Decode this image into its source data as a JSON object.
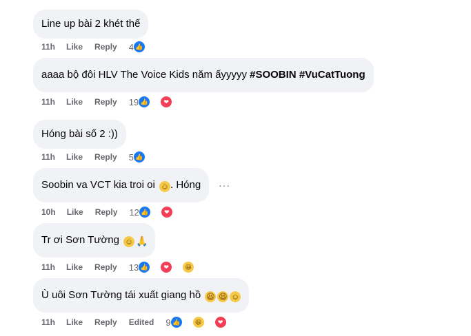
{
  "comments": [
    {
      "text": "Line up bài 2 khét thế",
      "time": "11h",
      "like": "Like",
      "reply": "Reply",
      "count": "4"
    },
    {
      "text": "aaaa bộ đôi HLV The Voice Kids năm ấyyyyy ",
      "tag1": "#SOOBIN",
      "tag2": "#VuCatTuong",
      "time": "11h",
      "like": "Like",
      "reply": "Reply",
      "count": "19"
    },
    {
      "text": "Hóng bài số 2 :))",
      "time": "11h",
      "like": "Like",
      "reply": "Reply",
      "count": "5"
    },
    {
      "text": "Soobin va VCT kia troi oi ",
      "suffix": ". Hóng",
      "time": "10h",
      "like": "Like",
      "reply": "Reply",
      "count": "12",
      "more": "···"
    },
    {
      "text": "Tr ơi Sơn Tường ",
      "time": "11h",
      "like": "Like",
      "reply": "Reply",
      "count": "13"
    },
    {
      "text": "Ù uôi Sơn Tường tái xuất giang hồ ",
      "time": "11h",
      "like": "Like",
      "reply": "Reply",
      "edited": "Edited",
      "count": "9"
    }
  ],
  "icons": {
    "like": "👍",
    "love": "❤",
    "haha": "😆",
    "smile": "☺",
    "pray": "🙏"
  }
}
